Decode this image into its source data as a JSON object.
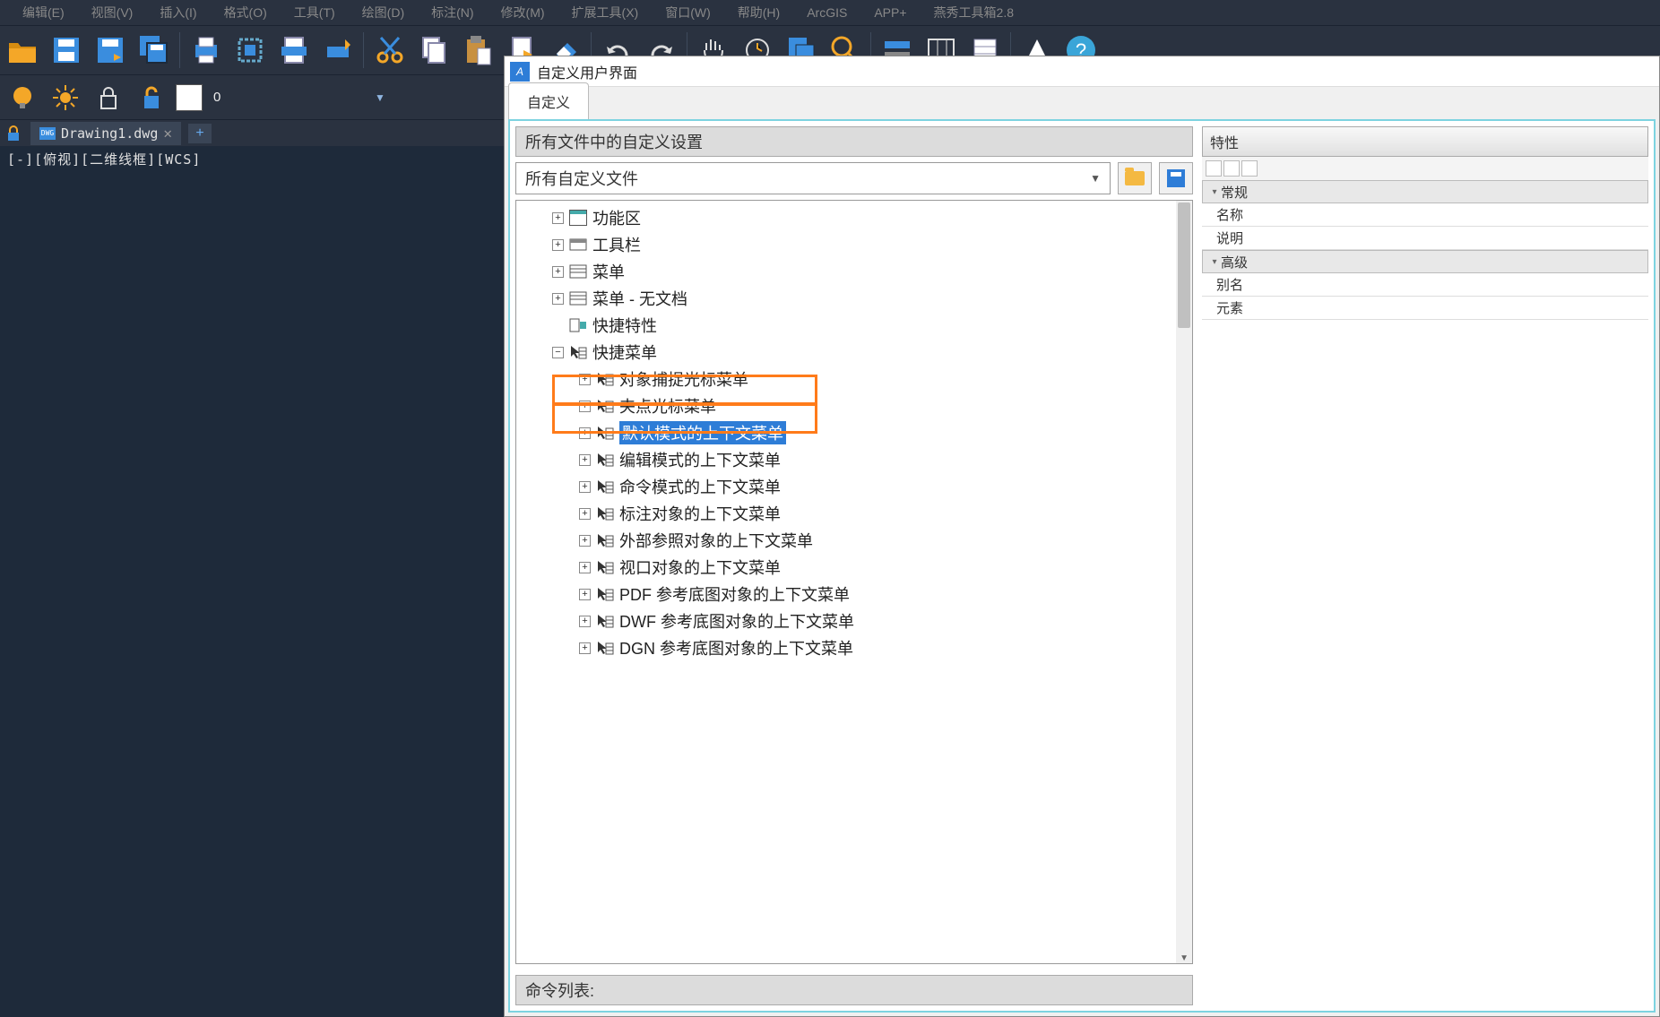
{
  "menu": [
    "编辑(E)",
    "视图(V)",
    "插入(I)",
    "格式(O)",
    "工具(T)",
    "绘图(D)",
    "标注(N)",
    "修改(M)",
    "扩展工具(X)",
    "窗口(W)",
    "帮助(H)",
    "ArcGIS",
    "APP+",
    "燕秀工具箱2.8"
  ],
  "toolbar2": {
    "value": "0"
  },
  "tab": {
    "filename": "Drawing1.dwg",
    "dwg_badge": "DWG"
  },
  "viewport_label": "[-][俯视][二维线框][WCS]",
  "dialog": {
    "title": "自定义用户界面",
    "tab": "自定义",
    "section_header": "所有文件中的自定义设置",
    "dropdown": "所有自定义文件",
    "tree": {
      "items": [
        {
          "indent": 1,
          "ex": "plus",
          "icon": "window",
          "label": "功能区"
        },
        {
          "indent": 1,
          "ex": "plus",
          "icon": "toolbar",
          "label": "工具栏"
        },
        {
          "indent": 1,
          "ex": "plus",
          "icon": "menu",
          "label": "菜单"
        },
        {
          "indent": 1,
          "ex": "plus",
          "icon": "menu",
          "label": "菜单 - 无文档"
        },
        {
          "indent": 1,
          "ex": "none",
          "icon": "quickprop",
          "label": "快捷特性"
        },
        {
          "indent": 1,
          "ex": "minus",
          "icon": "cursor",
          "label": "快捷菜单"
        },
        {
          "indent": 2,
          "ex": "plus",
          "icon": "cursor",
          "label": "对象捕捉光标菜单"
        },
        {
          "indent": 2,
          "ex": "plus",
          "icon": "cursor",
          "label": "夹点光标菜单"
        },
        {
          "indent": 2,
          "ex": "plus",
          "icon": "cursor",
          "label": "默认模式的上下文菜单",
          "selected": true
        },
        {
          "indent": 2,
          "ex": "plus",
          "icon": "cursor",
          "label": "编辑模式的上下文菜单"
        },
        {
          "indent": 2,
          "ex": "plus",
          "icon": "cursor",
          "label": "命令模式的上下文菜单"
        },
        {
          "indent": 2,
          "ex": "plus",
          "icon": "cursor",
          "label": "标注对象的上下文菜单"
        },
        {
          "indent": 2,
          "ex": "plus",
          "icon": "cursor",
          "label": "外部参照对象的上下文菜单"
        },
        {
          "indent": 2,
          "ex": "plus",
          "icon": "cursor",
          "label": "视口对象的上下文菜单"
        },
        {
          "indent": 2,
          "ex": "plus",
          "icon": "cursor",
          "label": "PDF 参考底图对象的上下文菜单"
        },
        {
          "indent": 2,
          "ex": "plus",
          "icon": "cursor",
          "label": "DWF 参考底图对象的上下文菜单"
        },
        {
          "indent": 2,
          "ex": "plus",
          "icon": "cursor",
          "label": "DGN 参考底图对象的上下文菜单"
        }
      ]
    },
    "cmd_list_header": "命令列表:",
    "properties": {
      "header": "特性",
      "groups": [
        {
          "name": "常规",
          "rows": [
            "名称",
            "说明"
          ]
        },
        {
          "name": "高级",
          "rows": [
            "别名",
            "元素"
          ]
        }
      ]
    }
  }
}
